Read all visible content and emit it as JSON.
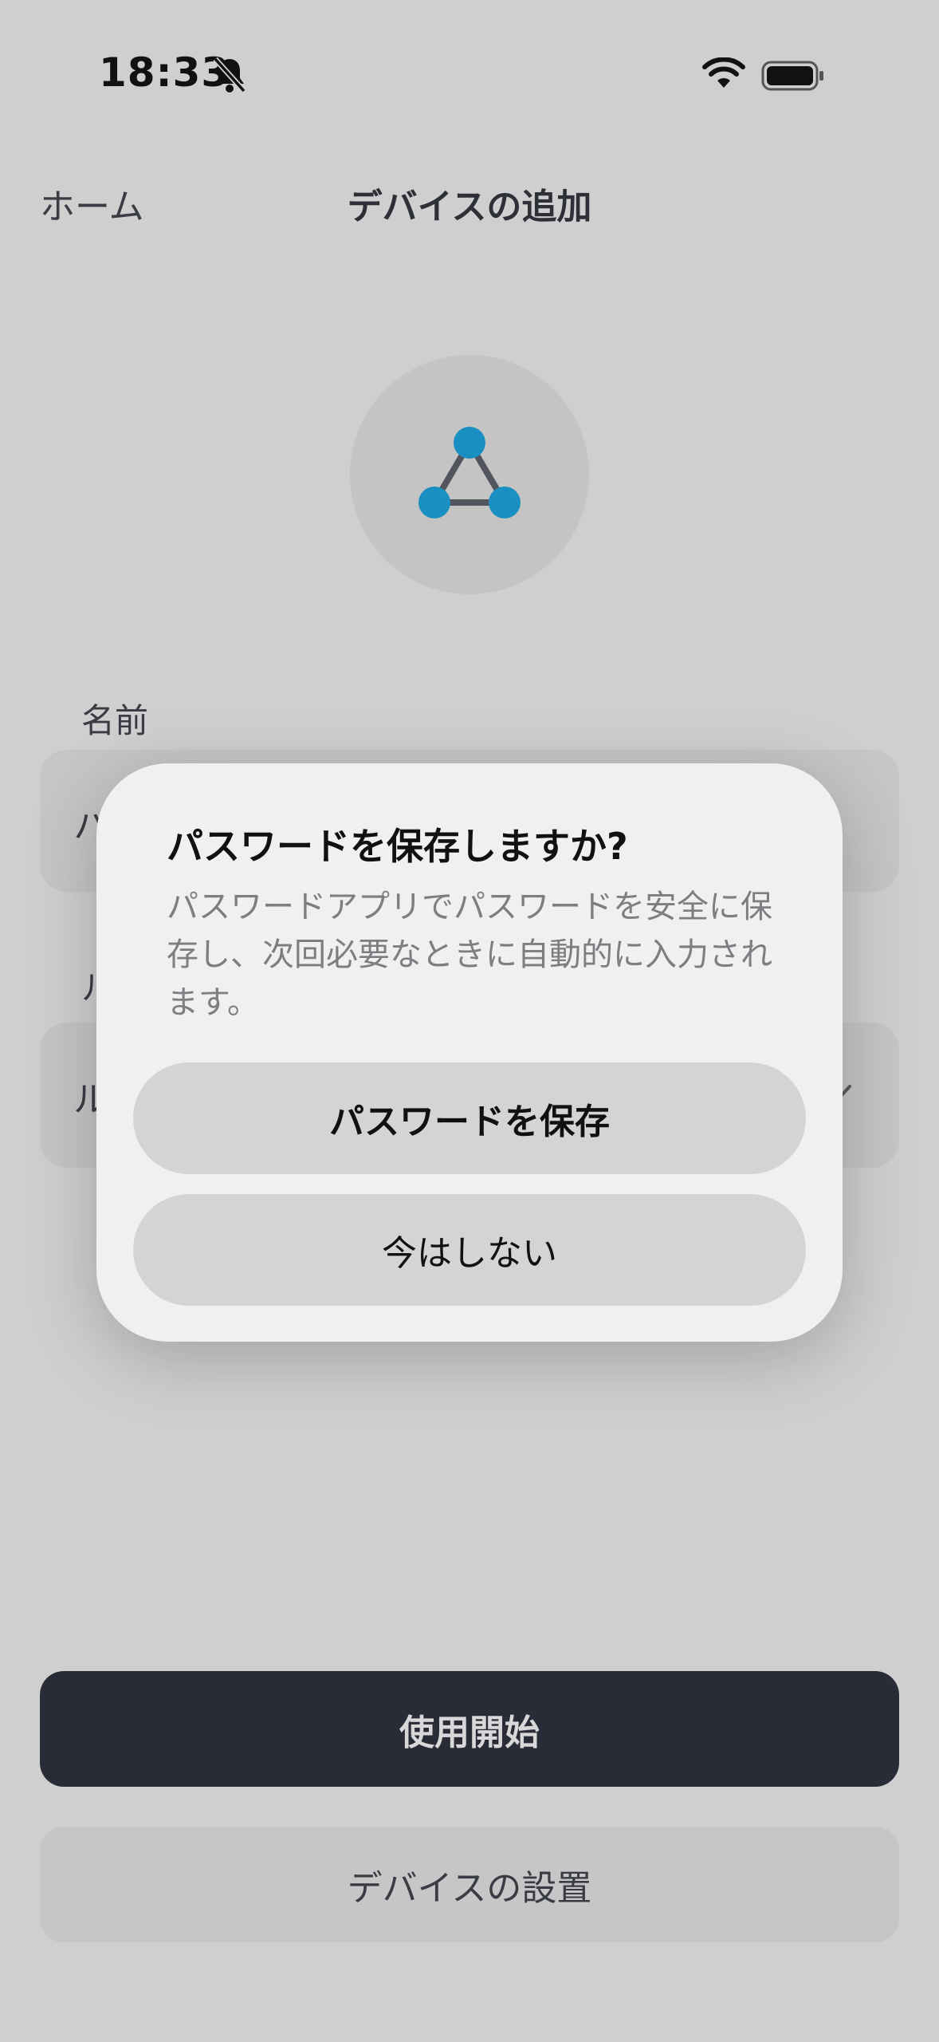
{
  "status_bar": {
    "time": "18:33",
    "icons": [
      "bell-slash-icon",
      "wifi-icon",
      "battery-icon"
    ]
  },
  "nav": {
    "back_label": "ホーム",
    "title": "デバイスの追加"
  },
  "hero": {
    "icon": "network-triangle-icon",
    "accent_color": "#1a8fc1"
  },
  "form": {
    "name_label": "名前",
    "name_value": "ハ",
    "second_label": "ル",
    "second_value": "ル"
  },
  "dialog": {
    "title": "パスワードを保存しますか?",
    "message": "パスワードアプリでパスワードを安全に保存し、次回必要なときに自動的に入力されます。",
    "save_label": "パスワードを保存",
    "cancel_label": "今はしない"
  },
  "actions": {
    "primary_label": "使用開始",
    "secondary_label": "デバイスの設置",
    "primary_color": "#292c36"
  }
}
